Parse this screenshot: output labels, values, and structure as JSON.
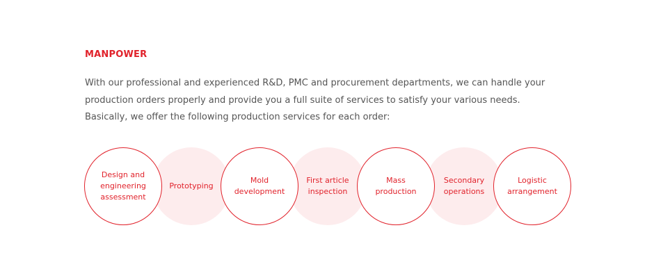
{
  "section": {
    "heading": "MANPOWER",
    "intro_lines": [
      "With our professional and experienced R&D, PMC and procurement departments, we can handle your",
      "production orders properly and provide you a full suite of services to satisfy your various needs.",
      "Basically, we offer the following production services for each order:"
    ]
  },
  "services": [
    {
      "lines": [
        "Design and",
        "engineering",
        "assessment"
      ],
      "style": "outline"
    },
    {
      "lines": [
        "Prototyping"
      ],
      "style": "filled"
    },
    {
      "lines": [
        "Mold",
        "development"
      ],
      "style": "outline"
    },
    {
      "lines": [
        "First article",
        "inspection"
      ],
      "style": "filled"
    },
    {
      "lines": [
        "Mass",
        "production"
      ],
      "style": "outline"
    },
    {
      "lines": [
        "Secondary",
        "operations"
      ],
      "style": "filled"
    },
    {
      "lines": [
        "Logistic",
        "arrangement"
      ],
      "style": "outline"
    }
  ],
  "colors": {
    "accent": "#e1222b",
    "filled_background": "#fdeced",
    "body_text": "#555555"
  }
}
